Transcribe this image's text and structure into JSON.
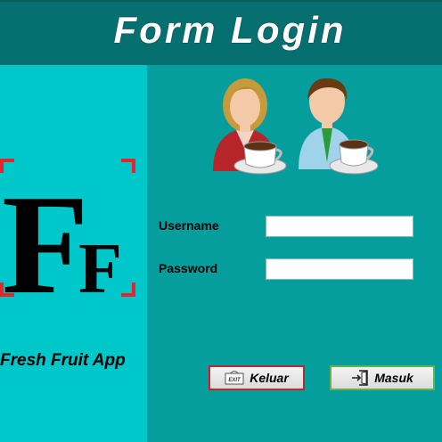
{
  "header": {
    "title": "Form Login"
  },
  "sidebar": {
    "logo_letters": "FF",
    "app_name": "Fresh Fruit App"
  },
  "form": {
    "username_label": "Username",
    "password_label": "Password",
    "username_value": "",
    "password_value": ""
  },
  "buttons": {
    "exit_label": "Keluar",
    "exit_icon_text": "EXIT",
    "login_label": "Masuk"
  },
  "colors": {
    "header": "#066f6f",
    "left_panel": "#00c7c9",
    "right_panel": "#069d9d",
    "logo_corner": "#e8232a"
  },
  "icons": [
    "logo-ff-icon",
    "users-coffee-icon",
    "exit-icon",
    "login-door-icon"
  ]
}
